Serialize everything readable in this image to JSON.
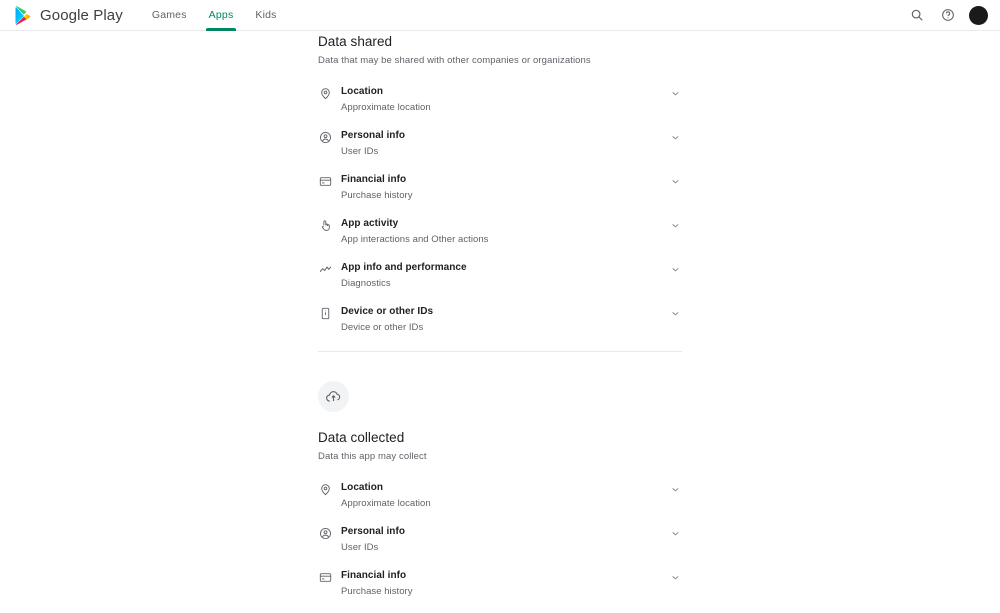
{
  "header": {
    "brand": "Google Play",
    "logo_icon": "google-play-logo",
    "tabs": [
      {
        "label": "Games",
        "active": false
      },
      {
        "label": "Apps",
        "active": true
      },
      {
        "label": "Kids",
        "active": false
      }
    ],
    "actions": [
      {
        "icon": "search-icon",
        "label": "Search"
      },
      {
        "icon": "help-icon",
        "label": "Help"
      }
    ],
    "avatar": {
      "icon": "avatar",
      "label": "Account"
    },
    "accent_color": "#01875f"
  },
  "data_shared": {
    "title": "Data shared",
    "subtitle": "Data that may be shared with other companies or organizations",
    "items": [
      {
        "icon": "location-pin-icon",
        "title": "Location",
        "subtitle": "Approximate location",
        "expand_icon": "chevron-down-icon"
      },
      {
        "icon": "person-circle-icon",
        "title": "Personal info",
        "subtitle": "User IDs",
        "expand_icon": "chevron-down-icon"
      },
      {
        "icon": "credit-card-icon",
        "title": "Financial info",
        "subtitle": "Purchase history",
        "expand_icon": "chevron-down-icon"
      },
      {
        "icon": "touch-app-icon",
        "title": "App activity",
        "subtitle": "App interactions and Other actions",
        "expand_icon": "chevron-down-icon"
      },
      {
        "icon": "analytics-icon",
        "title": "App info and performance",
        "subtitle": "Diagnostics",
        "expand_icon": "chevron-down-icon"
      },
      {
        "icon": "device-phone-icon",
        "title": "Device or other IDs",
        "subtitle": "Device or other IDs",
        "expand_icon": "chevron-down-icon"
      }
    ]
  },
  "data_collected": {
    "badge_icon": "cloud-upload-icon",
    "title": "Data collected",
    "subtitle": "Data this app may collect",
    "items": [
      {
        "icon": "location-pin-icon",
        "title": "Location",
        "subtitle": "Approximate location",
        "expand_icon": "chevron-down-icon"
      },
      {
        "icon": "person-circle-icon",
        "title": "Personal info",
        "subtitle": "User IDs",
        "expand_icon": "chevron-down-icon"
      },
      {
        "icon": "credit-card-icon",
        "title": "Financial info",
        "subtitle": "Purchase history",
        "expand_icon": "chevron-down-icon"
      }
    ]
  },
  "colors": {
    "accent": "#01875f",
    "text_primary": "#202124",
    "text_secondary": "#5f6368",
    "divider": "#e8eaed",
    "badge_bg": "#f1f3f4"
  }
}
